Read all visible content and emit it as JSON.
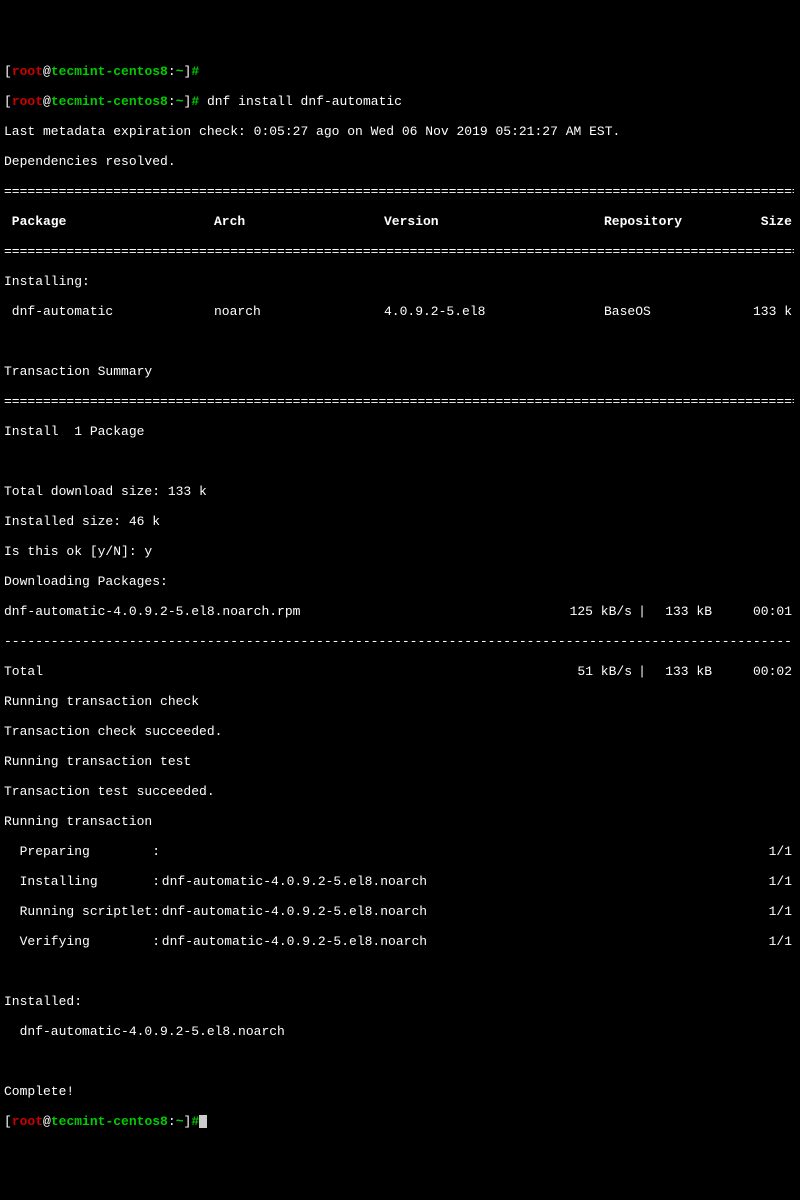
{
  "prompt": {
    "bracket_open": "[",
    "user": "root",
    "at": "@",
    "host": "tecmint-centos8",
    "colon": ":",
    "path": "~",
    "bracket_close": "]",
    "hash": "#"
  },
  "command": "dnf install dnf-automatic",
  "metadata_line": "Last metadata expiration check: 0:05:27 ago on Wed 06 Nov 2019 05:21:27 AM EST.",
  "deps_resolved": "Dependencies resolved.",
  "headers": {
    "package": " Package",
    "arch": "Arch",
    "version": "Version",
    "repository": "Repository",
    "size": "Size"
  },
  "installing_label": "Installing:",
  "pkg_row": {
    "name": " dnf-automatic",
    "arch": "noarch",
    "version": "4.0.9.2-5.el8",
    "repo": "BaseOS",
    "size": "133 k"
  },
  "transaction_summary": "Transaction Summary",
  "install_count": "Install  1 Package",
  "download_size": "Total download size: 133 k",
  "installed_size": "Installed size: 46 k",
  "confirm_prompt": "Is this ok [y/N]: y",
  "downloading_label": "Downloading Packages:",
  "download_row": {
    "name": "dnf-automatic-4.0.9.2-5.el8.noarch.rpm",
    "speed": "125 kB/s",
    "sep": "|",
    "size": "133 kB",
    "time": "00:01"
  },
  "total_row": {
    "label": "Total",
    "speed": "51 kB/s",
    "sep": "|",
    "size": "133 kB",
    "time": "00:02"
  },
  "trans_lines": {
    "check": "Running transaction check",
    "check_ok": "Transaction check succeeded.",
    "test": "Running transaction test",
    "test_ok": "Transaction test succeeded.",
    "running": "Running transaction"
  },
  "steps": {
    "preparing_label": "  Preparing        :",
    "preparing_pkg": " ",
    "preparing_prog": "1/1",
    "installing_label": "  Installing       :",
    "installing_pkg": " dnf-automatic-4.0.9.2-5.el8.noarch",
    "installing_prog": "1/1",
    "scriptlet_label": "  Running scriptlet:",
    "scriptlet_pkg": " dnf-automatic-4.0.9.2-5.el8.noarch",
    "scriptlet_prog": "1/1",
    "verifying_label": "  Verifying        :",
    "verifying_pkg": " dnf-automatic-4.0.9.2-5.el8.noarch",
    "verifying_prog": "1/1"
  },
  "installed_label": "Installed:",
  "installed_pkg": "  dnf-automatic-4.0.9.2-5.el8.noarch",
  "complete": "Complete!",
  "divider_eq": "================================================================================================================",
  "divider_dash": "----------------------------------------------------------------------------------------------------------------"
}
